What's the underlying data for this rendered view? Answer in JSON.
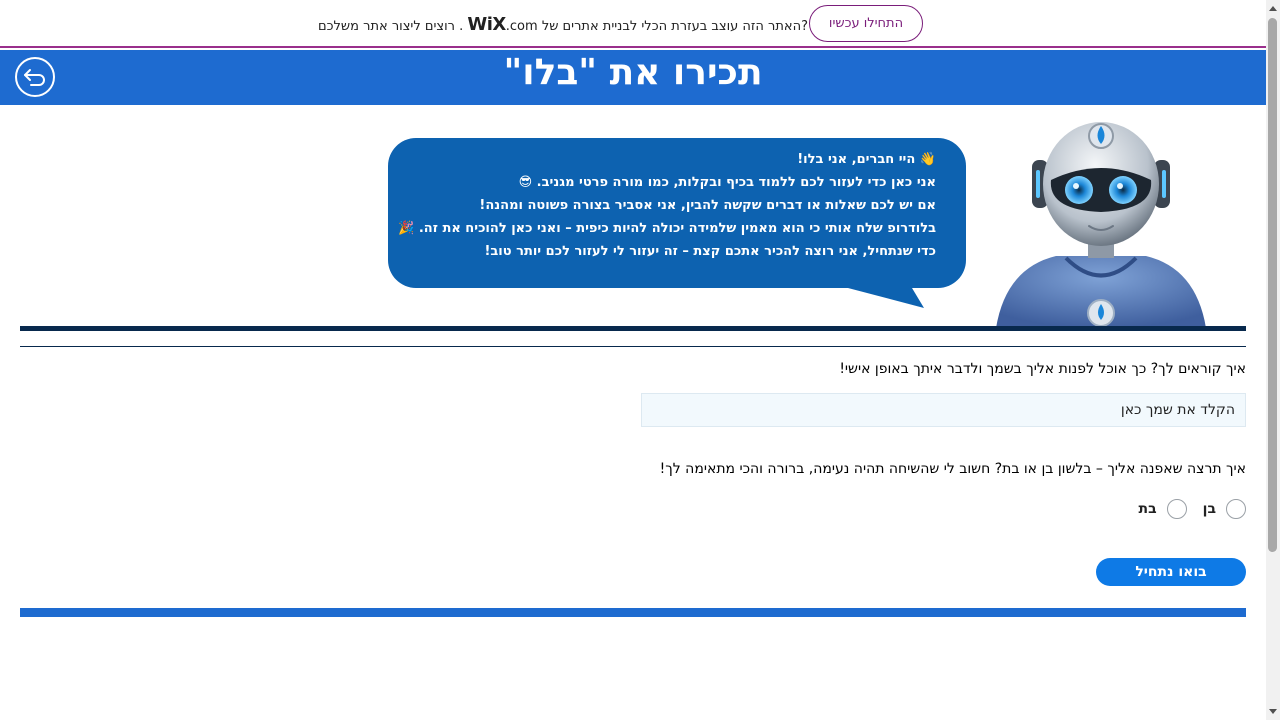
{
  "wix_banner": {
    "text_after_logo": "?האתר הזה עוצב בעזרת הכלי לבניית אתרים של",
    "logo_wix": "WiX",
    "logo_com": ".com",
    "text_before_logo": ". רוצים ליצור אתר משלכם",
    "button_label": "התחילו עכשיו"
  },
  "header": {
    "title": "תכירו את \"בלו\"",
    "back_icon": "back-arrow-icon"
  },
  "bubble": {
    "lines": [
      "👋 היי חברים, אני בלו!",
      "אני כאן כדי לעזור לכם ללמוד בכיף ובקלות, כמו מורה פרטי מגניב. 😎",
      "אם יש לכם שאלות או דברים שקשה להבין, אני אסביר בצורה פשוטה ומהנה!",
      "בלודרופ שלח אותי כי הוא מאמין שלמידה יכולה להיות כיפית – ואני כאן להוכיח את זה. 🎉",
      "כדי שנתחיל, אני רוצה להכיר אתכם קצת – זה יעזור לי לעזור לכם יותר טוב!"
    ]
  },
  "form": {
    "name_question": "איך קוראים לך? כך אוכל לפנות אליך בשמך ולדבר איתך באופן אישי!",
    "name_placeholder": "הקלד את שמך כאן",
    "gender_question": "איך תרצה שאפנה אליך – בלשון בן או בת? חשוב לי שהשיחה תהיה נעימה, ברורה והכי מתאימה לך!",
    "gender_options": [
      "בן",
      "בת"
    ],
    "start_button": "בואו נתחיל"
  },
  "colors": {
    "header_blue": "#1e6bd0",
    "bubble_blue": "#0d62b0",
    "button_blue": "#0e7ae6",
    "rule_navy": "#08294d",
    "wix_purple": "#7a1d7a"
  }
}
